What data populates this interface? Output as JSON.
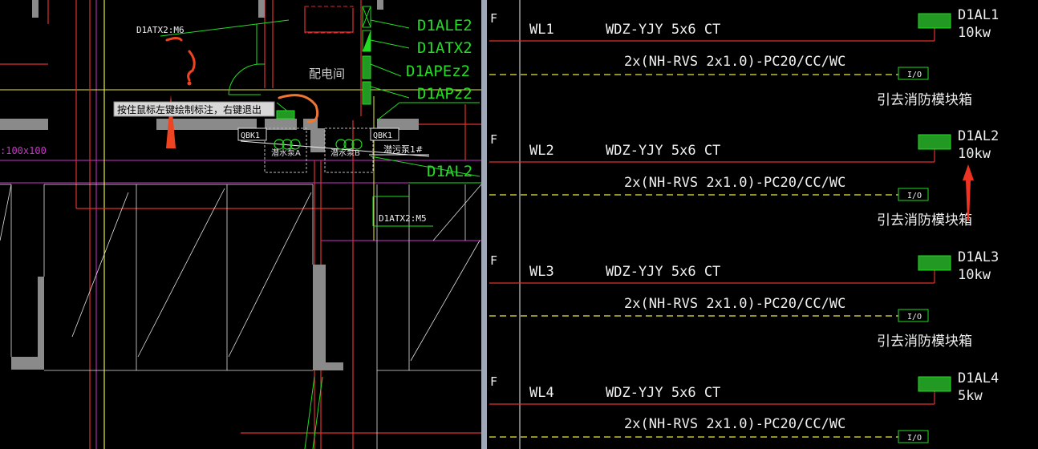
{
  "left_plan": {
    "labels": {
      "tag_top": "D1ATX2:M6",
      "tag_bottom": "D1ATX2:M5",
      "room": "配电间",
      "dim": ":100x100",
      "qbk_left": "QBK1",
      "qbk_right": "QBK1",
      "pump_left": "潜水泵A",
      "pump_right": "潜水泵B",
      "pump_note": "潜污泵1#"
    },
    "panels": [
      "D1ALE2",
      "D1ATX2",
      "D1APEz2",
      "D1APz2",
      "D1AL2"
    ],
    "tooltip": "按住鼠标左键绘制标注，右键退出",
    "annotation": {
      "question_mark": "?",
      "color": "#ee4422"
    }
  },
  "right_schedule": {
    "circuits": [
      {
        "phase": "F",
        "id": "WL1",
        "cable": "WDZ-YJY 5x6 CT",
        "ctrl": "2x(NH-RVS 2x1.0)-PC20/CC/WC",
        "io": "I/O",
        "dest": "引去消防模块箱",
        "panel": "D1AL1",
        "load": "10kw"
      },
      {
        "phase": "F",
        "id": "WL2",
        "cable": "WDZ-YJY 5x6 CT",
        "ctrl": "2x(NH-RVS 2x1.0)-PC20/CC/WC",
        "io": "I/O",
        "dest": "引去消防模块箱",
        "panel": "D1AL2",
        "load": "10kw"
      },
      {
        "phase": "F",
        "id": "WL3",
        "cable": "WDZ-YJY 5x6 CT",
        "ctrl": "2x(NH-RVS 2x1.0)-PC20/CC/WC",
        "io": "I/O",
        "dest": "引去消防模块箱",
        "panel": "D1AL3",
        "load": "10kw"
      },
      {
        "phase": "F",
        "id": "WL4",
        "cable": "WDZ-YJY 5x6 CT",
        "ctrl": "2x(NH-RVS 2x1.0)-PC20/CC/WC",
        "io": "I/O",
        "dest": "",
        "panel": "D1AL4",
        "load": "5kw"
      }
    ]
  },
  "colors": {
    "background": "#000000",
    "red_line": "#e03030",
    "green": "#22dd22",
    "yellow": "#e8e840",
    "white": "#f0f0f0",
    "magenta": "#cc33cc",
    "wall_gray": "#8a8a8a",
    "divider": "#a0a8b8"
  }
}
